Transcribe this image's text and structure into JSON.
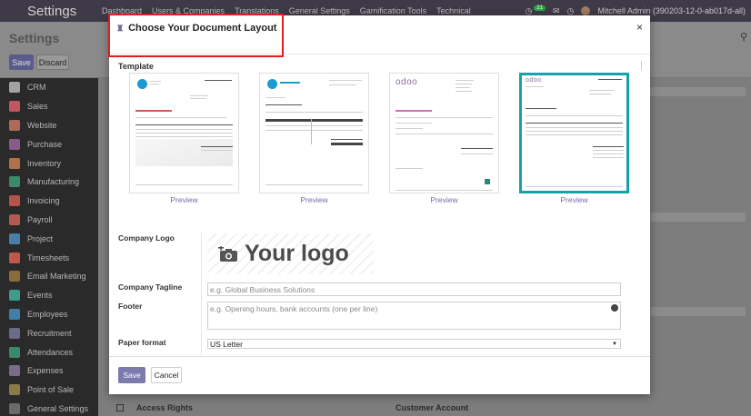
{
  "topbar": {
    "app_title": "Settings",
    "menu": [
      "Dashboard",
      "Users & Companies",
      "Translations",
      "General Settings",
      "Gamification Tools",
      "Technical"
    ],
    "badge": "21",
    "user": "Mitchell Admin (390203-12-0-ab017d-all)"
  },
  "control": {
    "title": "Settings",
    "save_label": "Save",
    "discard_label": "Discard"
  },
  "sidebar": {
    "items": [
      {
        "label": "CRM",
        "color": "#a3a3a3"
      },
      {
        "label": "Sales",
        "color": "#c0575f"
      },
      {
        "label": "Website",
        "color": "#b06a5a"
      },
      {
        "label": "Purchase",
        "color": "#8a5a8a"
      },
      {
        "label": "Inventory",
        "color": "#b27248"
      },
      {
        "label": "Manufacturing",
        "color": "#3c8a6a"
      },
      {
        "label": "Invoicing",
        "color": "#b6544a"
      },
      {
        "label": "Payroll",
        "color": "#b25a52"
      },
      {
        "label": "Project",
        "color": "#4c7fa8"
      },
      {
        "label": "Timesheets",
        "color": "#c0574d"
      },
      {
        "label": "Email Marketing",
        "color": "#8a6b3a"
      },
      {
        "label": "Events",
        "color": "#3f9c8a"
      },
      {
        "label": "Employees",
        "color": "#3f7fa8"
      },
      {
        "label": "Recruitment",
        "color": "#6b6b8a"
      },
      {
        "label": "Attendances",
        "color": "#3a8a6a"
      },
      {
        "label": "Expenses",
        "color": "#7a6b8a"
      },
      {
        "label": "Point of Sale",
        "color": "#8a7a4a"
      },
      {
        "label": "General Settings",
        "color": "#6a6a6a"
      }
    ]
  },
  "background": {
    "access_rights": "Access Rights",
    "customer_account": "Customer Account"
  },
  "modal": {
    "title": "Choose Your Document Layout",
    "close": "×",
    "template_label": "Template",
    "templates": [
      {
        "preview": "Preview",
        "selected": false
      },
      {
        "preview": "Preview",
        "selected": false
      },
      {
        "preview": "Preview",
        "selected": false
      },
      {
        "preview": "Preview",
        "selected": true
      }
    ],
    "company_logo_label": "Company Logo",
    "logo_text": "Your logo",
    "company_tagline_label": "Company Tagline",
    "tagline_placeholder": "e.g. Global Business Solutions",
    "footer_label": "Footer",
    "footer_placeholder": "e.g. Opening hours, bank accounts (one per line)",
    "paper_format_label": "Paper format",
    "paper_format_value": "US Letter",
    "save_label": "Save",
    "cancel_label": "Cancel"
  },
  "colors": {
    "accent": "#7c7bad",
    "selected_border": "#16a2a8",
    "highlight": "#e31b1b"
  }
}
